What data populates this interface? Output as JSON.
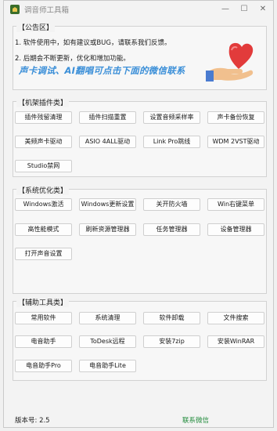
{
  "window": {
    "title": "调音师工具箱",
    "controls": {
      "minimize": "—",
      "maximize": "☐",
      "close": "✕"
    }
  },
  "notice": {
    "title": "【公告区】",
    "lines": [
      "1. 软件使用中，如有建议或BUG，请联系我们反馈。",
      "2. 后期会不断更新，优化和增加功能。"
    ],
    "promo": "声卡调试、AI翻唱可点击下面的微信联系"
  },
  "sections": [
    {
      "title": "【机架插件类】",
      "buttons": [
        "插件残留清理",
        "插件扫描重置",
        "设置音频采样率",
        "声卡备份恢复",
        "美频声卡驱动",
        "ASIO 4ALL驱动",
        "Link Pro跳线",
        "WDM 2VST驱动",
        "Studio禁网"
      ]
    },
    {
      "title": "【系统优化类】",
      "buttons": [
        "Windows激活",
        "Windows更新设置",
        "关开防火墙",
        "Win右键菜单",
        "高性能模式",
        "刷新资源管理器",
        "任务管理器",
        "设备管理器",
        "打开声音设置"
      ]
    },
    {
      "title": "【辅助工具类】",
      "buttons": [
        "常用软件",
        "系统清理",
        "软件卸载",
        "文件搜索",
        "电音助手",
        "ToDesk远程",
        "安装7zip",
        "安装WinRAR",
        "电音助手Pro",
        "电音助手Lite"
      ]
    }
  ],
  "footer": {
    "version": "版本号: 2.5",
    "contact": "联系微信"
  },
  "colors": {
    "promo": "#3b8fd8",
    "contact": "#1f8a3a"
  }
}
